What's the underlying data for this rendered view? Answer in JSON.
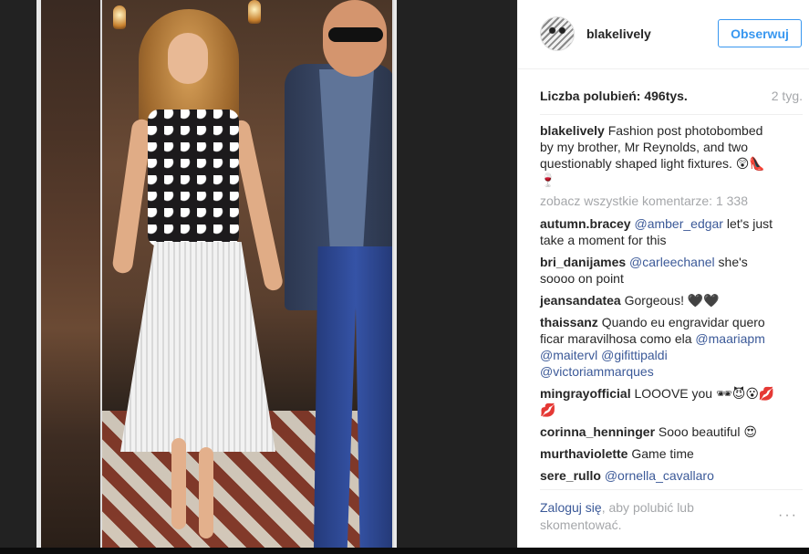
{
  "post": {
    "username": "blakelively",
    "follow_label": "Obserwuj",
    "likes_label": "Liczba polubień: 496tys.",
    "time_ago": "2 tyg.",
    "caption_user": "blakelively",
    "caption_text": "Fashion post photobombed by my brother, Mr Reynolds, and two questionably shaped light fixtures. 😲👠🍷",
    "view_all_comments": "zobacz wszystkie komentarze: 1 338"
  },
  "comments": [
    {
      "user": "autumn.bracey",
      "mention": "@amber_edgar",
      "text": " let's just take a moment for this"
    },
    {
      "user": "bri_danijames",
      "mention": "@carleechanel",
      "text": " she's soooo on point"
    },
    {
      "user": "jeansandatea",
      "mention": "",
      "text": "Gorgeous! 🖤🖤"
    },
    {
      "user": "thaissanz",
      "mention": "",
      "text": "Quando eu engravidar quero ficar maravilhosa como ela ",
      "mentions_after": "@maariapm @maitervl @gifittipaldi @victoriammarques"
    },
    {
      "user": "mingrayofficial",
      "mention": "",
      "text": "LOOOVE you 🕶😈😮💋💋"
    },
    {
      "user": "corinna_henninger",
      "mention": "",
      "text": "Sooo beautiful 😍"
    },
    {
      "user": "murthaviolette",
      "mention": "",
      "text": "Game time"
    },
    {
      "user": "sere_rullo",
      "mention": "@ornella_cavallaro",
      "text": ""
    }
  ],
  "footer": {
    "login_link": "Zaloguj się",
    "login_rest": ", aby polubić lub skomentować.",
    "more": "···"
  },
  "icons": {
    "more": "more-options-icon"
  }
}
